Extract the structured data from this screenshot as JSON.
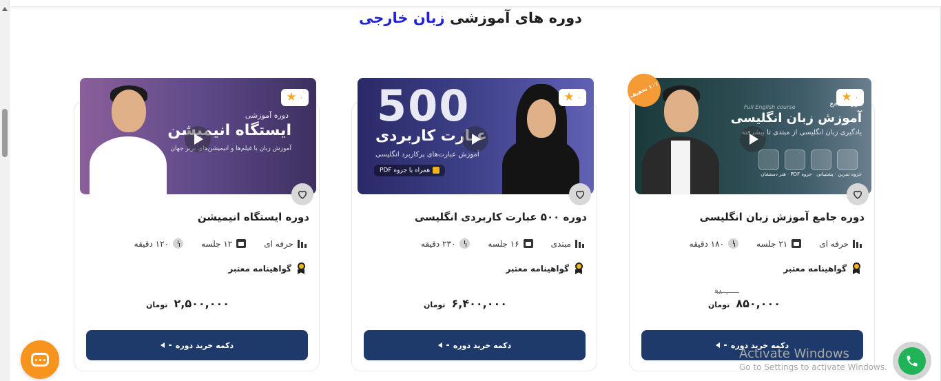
{
  "section": {
    "title_prefix": "دوره های آموزشی",
    "title_highlight": "زبان خارجی"
  },
  "courses": [
    {
      "image": {
        "kicker": "دوره جامع",
        "headline": "آموزش زبان انگلیسی",
        "subtext": "یادگیری زبان انگلیسی از مبتدی تا پیشرفته",
        "watermark": "Full English course",
        "features": [
          "جزوه تمرین",
          "پشتیبانی",
          "جزوه PDF",
          "هنر دستشان"
        ]
      },
      "discount_badge": "۱۰٪ تخفیف",
      "rating": "۰",
      "title": "دوره جامع آموزش زبان انگلیسی",
      "level": "حرفه ای",
      "sessions": "۲۱ جلسه",
      "duration": "۱۸۰ دقیقه",
      "certificate": "گواهینامه معتبر",
      "old_price": "۹۸۰,۰۰۰",
      "price": "۸۵۰,۰۰۰",
      "currency": "تومان",
      "buy_label": "دکمه خرید دوره"
    },
    {
      "image": {
        "big_number": "500",
        "headline": "عبارت کاربردی",
        "subtext": "آموزش عبارت‌های پرکاربرد انگلیسی",
        "tag": "همراه با جزوه PDF"
      },
      "rating": "۰",
      "title": "دوره ۵۰۰ عبارت کاربردی انگلیسی",
      "level": "مبتدی",
      "sessions": "۱۶ جلسه",
      "duration": "۲۳۰ دقیقه",
      "certificate": "گواهینامه معتبر",
      "price": "۶,۴۰۰,۰۰۰",
      "currency": "تومان",
      "buy_label": "دکمه خرید دوره"
    },
    {
      "image": {
        "kicker": "دوره آموزشی",
        "headline": "ایستگاه انیمیشن",
        "subtext": "آموزش زبان با فیلم‌ها و انیمیشن‌های برتر جهان"
      },
      "rating": "۰",
      "title": "دوره ایستگاه انیمیشن",
      "level": "حرفه ای",
      "sessions": "۱۲ جلسه",
      "duration": "۱۲۰ دقیقه",
      "certificate": "گواهینامه معتبر",
      "price": "۲,۵۰۰,۰۰۰",
      "currency": "تومان",
      "buy_label": "دکمه خرید دوره"
    }
  ],
  "watermark": {
    "line1": "Activate Windows",
    "line2": "Go to Settings to activate Windows."
  },
  "colors": {
    "accent": "#1d22d8",
    "button": "#1e3a6b",
    "chat": "#f7941d",
    "phone": "#20b358",
    "discount": "#f49b36",
    "star": "#f5a623"
  },
  "icons": [
    "chat-icon",
    "phone-icon",
    "heart-icon",
    "star-icon",
    "play-icon",
    "level-icon",
    "calendar-icon",
    "clock-icon",
    "medal-icon"
  ]
}
